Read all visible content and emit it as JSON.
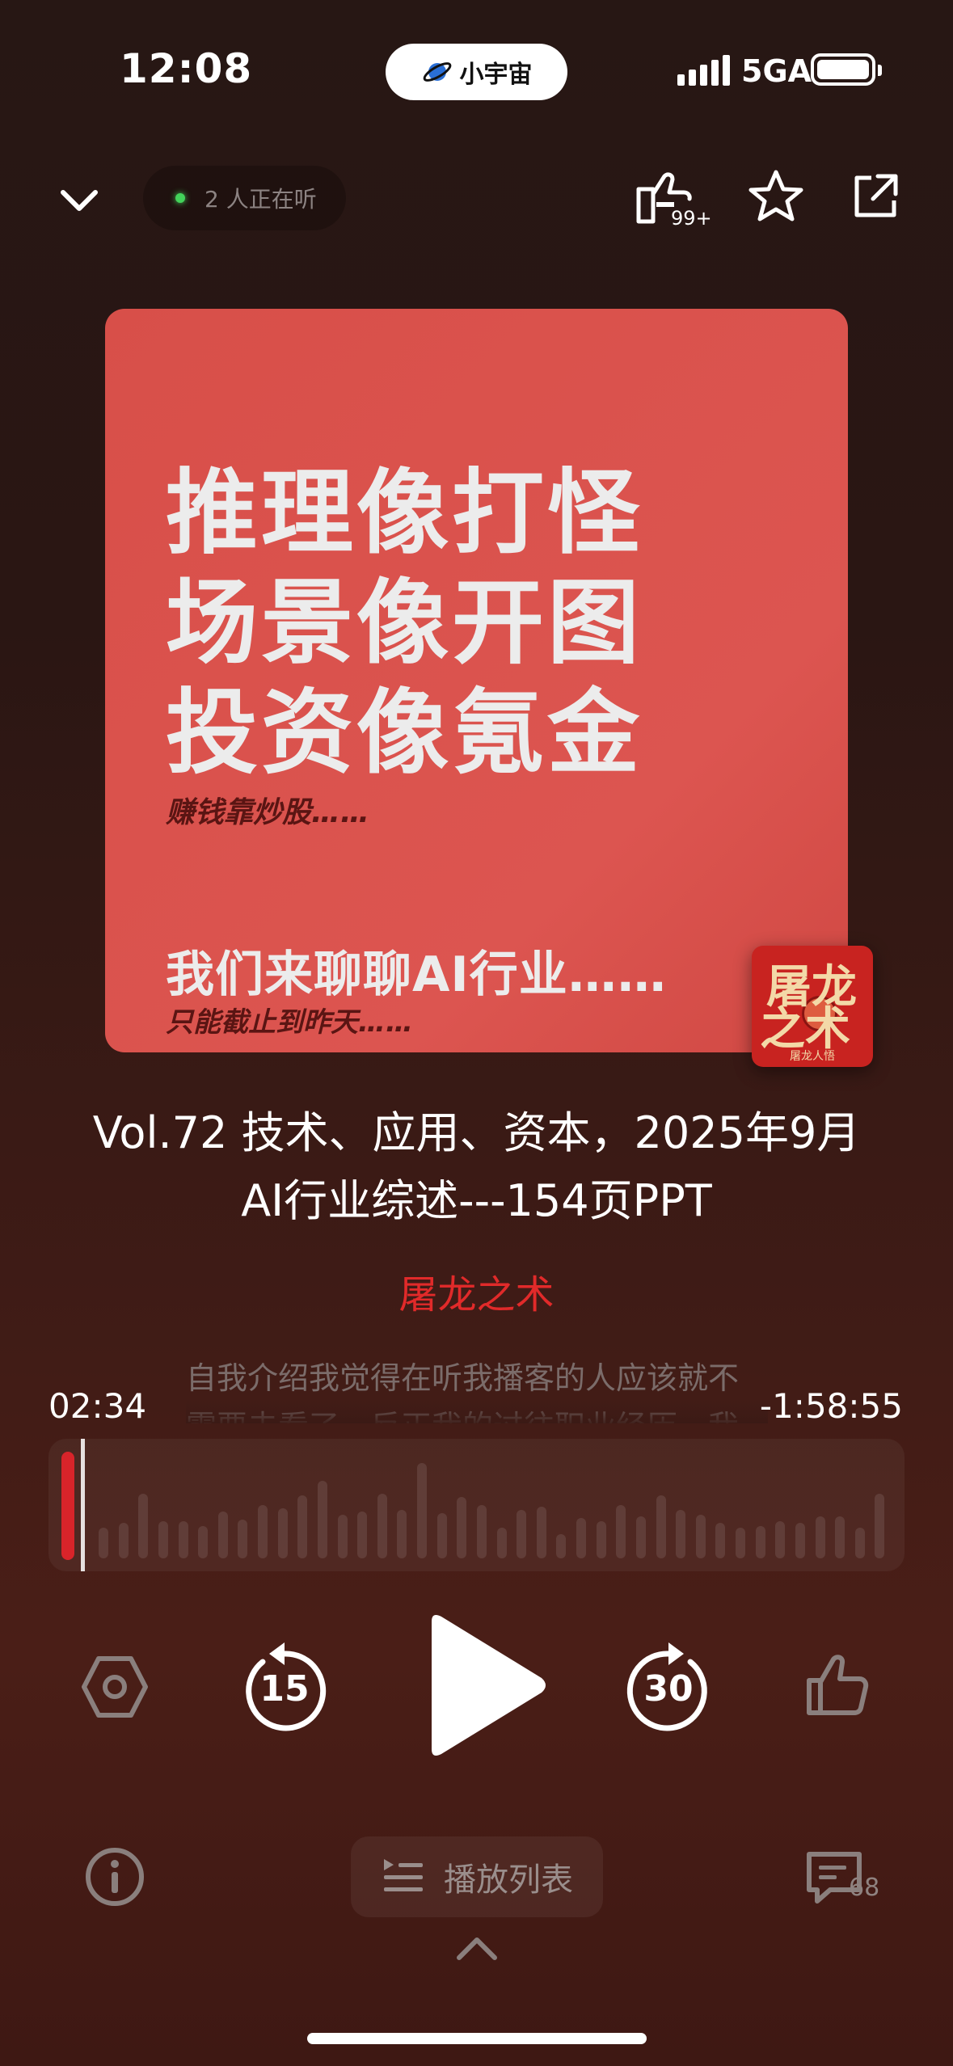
{
  "status_bar": {
    "time": "12:08",
    "island_label": "小宇宙",
    "network": "5GA"
  },
  "header": {
    "listeners": "2 人正在听",
    "like_count": "99+"
  },
  "cover": {
    "line1": "推理像打怪",
    "line2": "场景像开图",
    "line3": "投资像氪金",
    "sub1": "赚钱靠炒股……",
    "main2": "我们来聊聊AI行业……",
    "sub2": "只能截止到昨天……",
    "badge_line1": "屠龙",
    "badge_line2": "之术",
    "badge_caption": "屠龙人悟"
  },
  "episode": {
    "title_line1": "Vol.72 技术、应用、资本，2025年9月",
    "title_line2": "AI行业综述---154页PPT",
    "podcast_name": "屠龙之术"
  },
  "transcript": {
    "line1": "自我介绍我觉得在听我播客的人应该就不",
    "line2": "需要去看了，反正我的过往职业经历，我"
  },
  "player": {
    "elapsed": "02:34",
    "remaining": "-1:58:55",
    "progress_fraction": 0.021,
    "rewind_seconds": "15",
    "forward_seconds": "30"
  },
  "bottom": {
    "playlist_label": "播放列表",
    "comment_count": "68"
  },
  "colors": {
    "accent_red": "#e12a2a",
    "cover_red": "#d84f49",
    "listening_dot": "#43d25a"
  },
  "icons": [
    "chevron-down-icon",
    "like-icon",
    "star-icon",
    "share-icon",
    "speed-icon",
    "rewind-15-icon",
    "play-icon",
    "forward-30-icon",
    "thumbs-up-icon",
    "info-icon",
    "playlist-icon",
    "comment-icon",
    "chevron-up-icon"
  ]
}
